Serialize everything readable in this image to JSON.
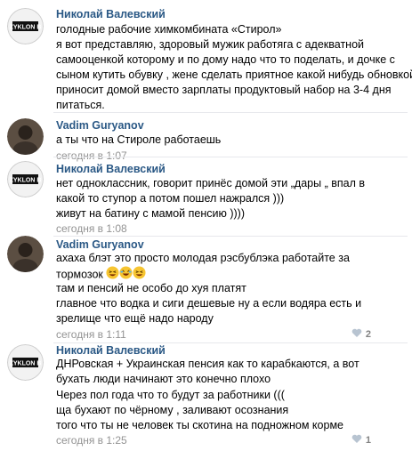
{
  "comments": [
    {
      "author": "Николай Валевский",
      "avatar": "zyklon-logo-avatar",
      "lines": [
        "голодные рабочие химкомбината «Стирол»",
        "я вот представляю, здоровый мужик работяга с адекватной",
        "самооценкой которому и по дому надо что то поделать, и дочке с",
        "сыном кутить обувку , жене сделать приятное какой нибудь обновкой",
        "приносит домой вместо зарплаты продуктовый набор на 3-4 дня",
        "питаться."
      ]
    },
    {
      "author": "Vadim Guryanov",
      "avatar": "dark-photo-avatar",
      "lines": [
        "а ты что на Стироле работаешь"
      ],
      "date": "сегодня в 1:07"
    },
    {
      "author": "Николай Валевский",
      "avatar": "zyklon-logo-avatar",
      "lines": [
        "нет одноклассник, говорит принёс домой эти „дары „ впал в",
        "какой то ступор а потом пошел нажрался )))",
        "живут на батину с мамой пенсию ))))"
      ],
      "date": "сегодня в 1:08"
    },
    {
      "author": "Vadim Guryanov",
      "avatar": "dark-photo-avatar",
      "lines": [
        "ахаха блэт это просто молодая рэсбублэка работайте за",
        "тормозок",
        "там и пенсий не особо до хуя платят",
        "главное что водка и сиги дешевые ну а если водяра есть и",
        "зрелище что ещё надо народу"
      ],
      "emojis": [
        "laughing-emoji",
        "rolling-laughing-emoji",
        "laughing-emoji"
      ],
      "date": "сегодня в 1:11",
      "likes": "2"
    },
    {
      "author": "Николай Валевский",
      "avatar": "zyklon-logo-avatar",
      "lines": [
        "ДНРовская + Украинская пенсия как то карабкаются, а вот",
        "бухать люди начинают это конечно плохо",
        "Через пол года что то будут за работники (((",
        "ща бухают по чёрному , заливают осознания",
        "того что ты не человек ты скотина на подножном корме"
      ],
      "date": "сегодня в 1:25",
      "likes": "1"
    }
  ],
  "colors": {
    "author": "#2a5885",
    "date": "#939393",
    "divider": "#e7e8ec"
  }
}
